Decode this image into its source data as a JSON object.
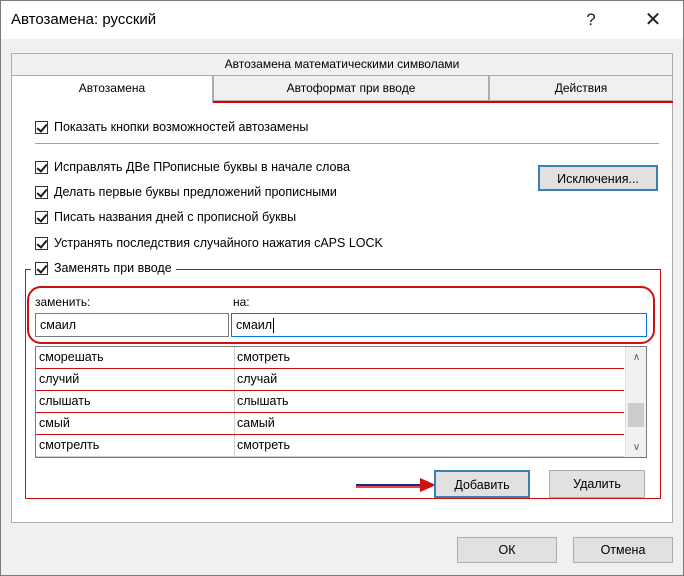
{
  "window": {
    "title": "Автозамена: русский",
    "help_glyph": "?",
    "close_glyph": "✕"
  },
  "tabs": {
    "top": "Автозамена математическими символами",
    "items": [
      {
        "label": "Автозамена",
        "active": true
      },
      {
        "label": "Автоформат при вводе",
        "active": false
      },
      {
        "label": "Действия",
        "active": false
      }
    ]
  },
  "options": {
    "show_buttons": "Показать кнопки возможностей автозамены",
    "fix_two_caps": "Исправлять ДВе ПРописные буквы в начале слова",
    "capitalize_sentence": "Делать первые буквы предложений прописными",
    "capitalize_days": "Писать названия дней с прописной буквы",
    "fix_caps_lock": "Устранять последствия случайного нажатия cAPS LOCK",
    "replace_as_you_type": "Заменять при вводе"
  },
  "buttons": {
    "exceptions": "Исключения...",
    "add": "Добавить",
    "delete": "Удалить",
    "ok": "ОК",
    "cancel": "Отмена"
  },
  "replace": {
    "col_replace": "заменить:",
    "col_with": "на:",
    "replace_value": "смаил",
    "with_value": "смаил"
  },
  "list": {
    "rows": [
      {
        "from": "сморешать",
        "to": "смотреть"
      },
      {
        "from": "случий",
        "to": "случай"
      },
      {
        "from": "слышать",
        "to": "слышать"
      },
      {
        "from": "смый",
        "to": "самый"
      },
      {
        "from": "смотрелть",
        "to": "смотреть"
      }
    ],
    "scroll_up": "∧",
    "scroll_down": "∨"
  },
  "colors": {
    "annotation_red": "#d01010",
    "focus_blue": "#3c7fb1"
  }
}
